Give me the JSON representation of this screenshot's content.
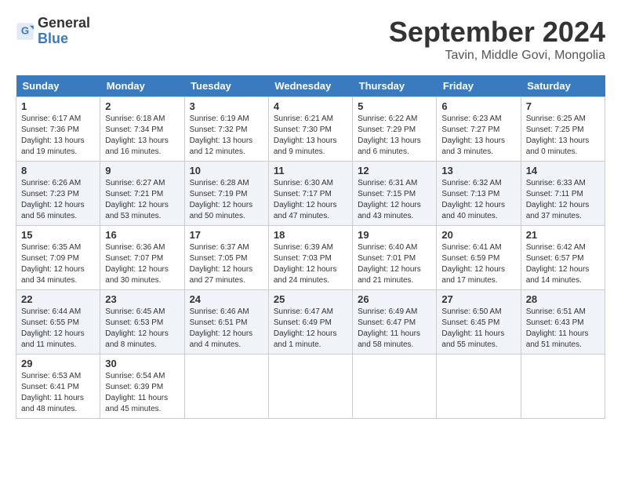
{
  "header": {
    "logo_general": "General",
    "logo_blue": "Blue",
    "month": "September 2024",
    "location": "Tavin, Middle Govi, Mongolia"
  },
  "days_of_week": [
    "Sunday",
    "Monday",
    "Tuesday",
    "Wednesday",
    "Thursday",
    "Friday",
    "Saturday"
  ],
  "weeks": [
    [
      {
        "day": "1",
        "sunrise": "6:17 AM",
        "sunset": "7:36 PM",
        "daylight": "13 hours and 19 minutes."
      },
      {
        "day": "2",
        "sunrise": "6:18 AM",
        "sunset": "7:34 PM",
        "daylight": "13 hours and 16 minutes."
      },
      {
        "day": "3",
        "sunrise": "6:19 AM",
        "sunset": "7:32 PM",
        "daylight": "13 hours and 12 minutes."
      },
      {
        "day": "4",
        "sunrise": "6:21 AM",
        "sunset": "7:30 PM",
        "daylight": "13 hours and 9 minutes."
      },
      {
        "day": "5",
        "sunrise": "6:22 AM",
        "sunset": "7:29 PM",
        "daylight": "13 hours and 6 minutes."
      },
      {
        "day": "6",
        "sunrise": "6:23 AM",
        "sunset": "7:27 PM",
        "daylight": "13 hours and 3 minutes."
      },
      {
        "day": "7",
        "sunrise": "6:25 AM",
        "sunset": "7:25 PM",
        "daylight": "13 hours and 0 minutes."
      }
    ],
    [
      {
        "day": "8",
        "sunrise": "6:26 AM",
        "sunset": "7:23 PM",
        "daylight": "12 hours and 56 minutes."
      },
      {
        "day": "9",
        "sunrise": "6:27 AM",
        "sunset": "7:21 PM",
        "daylight": "12 hours and 53 minutes."
      },
      {
        "day": "10",
        "sunrise": "6:28 AM",
        "sunset": "7:19 PM",
        "daylight": "12 hours and 50 minutes."
      },
      {
        "day": "11",
        "sunrise": "6:30 AM",
        "sunset": "7:17 PM",
        "daylight": "12 hours and 47 minutes."
      },
      {
        "day": "12",
        "sunrise": "6:31 AM",
        "sunset": "7:15 PM",
        "daylight": "12 hours and 43 minutes."
      },
      {
        "day": "13",
        "sunrise": "6:32 AM",
        "sunset": "7:13 PM",
        "daylight": "12 hours and 40 minutes."
      },
      {
        "day": "14",
        "sunrise": "6:33 AM",
        "sunset": "7:11 PM",
        "daylight": "12 hours and 37 minutes."
      }
    ],
    [
      {
        "day": "15",
        "sunrise": "6:35 AM",
        "sunset": "7:09 PM",
        "daylight": "12 hours and 34 minutes."
      },
      {
        "day": "16",
        "sunrise": "6:36 AM",
        "sunset": "7:07 PM",
        "daylight": "12 hours and 30 minutes."
      },
      {
        "day": "17",
        "sunrise": "6:37 AM",
        "sunset": "7:05 PM",
        "daylight": "12 hours and 27 minutes."
      },
      {
        "day": "18",
        "sunrise": "6:39 AM",
        "sunset": "7:03 PM",
        "daylight": "12 hours and 24 minutes."
      },
      {
        "day": "19",
        "sunrise": "6:40 AM",
        "sunset": "7:01 PM",
        "daylight": "12 hours and 21 minutes."
      },
      {
        "day": "20",
        "sunrise": "6:41 AM",
        "sunset": "6:59 PM",
        "daylight": "12 hours and 17 minutes."
      },
      {
        "day": "21",
        "sunrise": "6:42 AM",
        "sunset": "6:57 PM",
        "daylight": "12 hours and 14 minutes."
      }
    ],
    [
      {
        "day": "22",
        "sunrise": "6:44 AM",
        "sunset": "6:55 PM",
        "daylight": "12 hours and 11 minutes."
      },
      {
        "day": "23",
        "sunrise": "6:45 AM",
        "sunset": "6:53 PM",
        "daylight": "12 hours and 8 minutes."
      },
      {
        "day": "24",
        "sunrise": "6:46 AM",
        "sunset": "6:51 PM",
        "daylight": "12 hours and 4 minutes."
      },
      {
        "day": "25",
        "sunrise": "6:47 AM",
        "sunset": "6:49 PM",
        "daylight": "12 hours and 1 minute."
      },
      {
        "day": "26",
        "sunrise": "6:49 AM",
        "sunset": "6:47 PM",
        "daylight": "11 hours and 58 minutes."
      },
      {
        "day": "27",
        "sunrise": "6:50 AM",
        "sunset": "6:45 PM",
        "daylight": "11 hours and 55 minutes."
      },
      {
        "day": "28",
        "sunrise": "6:51 AM",
        "sunset": "6:43 PM",
        "daylight": "11 hours and 51 minutes."
      }
    ],
    [
      {
        "day": "29",
        "sunrise": "6:53 AM",
        "sunset": "6:41 PM",
        "daylight": "11 hours and 48 minutes."
      },
      {
        "day": "30",
        "sunrise": "6:54 AM",
        "sunset": "6:39 PM",
        "daylight": "11 hours and 45 minutes."
      },
      null,
      null,
      null,
      null,
      null
    ]
  ]
}
